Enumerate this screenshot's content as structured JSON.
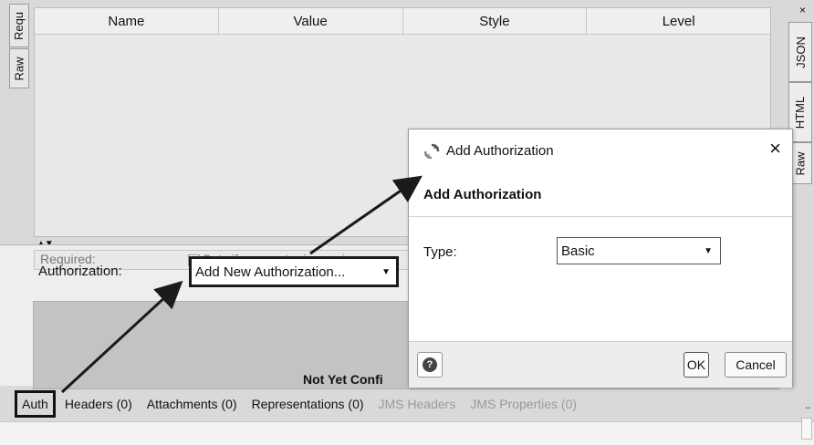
{
  "left_tabs": {
    "request": "Requ",
    "raw": "Raw"
  },
  "right_tabs": {
    "json": "JSON",
    "html": "HTML",
    "raw": "Raw",
    "close": "×",
    "more": ".."
  },
  "params_table": {
    "columns": [
      "Name",
      "Value",
      "Style",
      "Level"
    ],
    "rows": [],
    "sort_arrows": "▲▼"
  },
  "required_row": {
    "label": "Required:",
    "checkbox_text": "Sets if parameter is require"
  },
  "auth": {
    "label": "Authorization:",
    "select_value": "Add New Authorization...",
    "not_configured": "Not Yet Confi"
  },
  "bottom_tabs": [
    {
      "label": "Auth",
      "active": true,
      "enabled": true
    },
    {
      "label": "Headers (0)",
      "active": false,
      "enabled": true
    },
    {
      "label": "Attachments (0)",
      "active": false,
      "enabled": true
    },
    {
      "label": "Representations (0)",
      "active": false,
      "enabled": true
    },
    {
      "label": "JMS Headers",
      "active": false,
      "enabled": false
    },
    {
      "label": "JMS Properties (0)",
      "active": false,
      "enabled": false
    }
  ],
  "dialog": {
    "title": "Add Authorization",
    "heading": "Add Authorization",
    "close": "×",
    "type_label": "Type:",
    "type_value": "Basic",
    "help_icon": "?",
    "ok_label": "OK",
    "cancel_label": "Cancel"
  },
  "colors": {
    "highlight_border": "#1a1a1a",
    "arrow": "#1a1a1a",
    "disabled_text": "#9a9a9a"
  }
}
